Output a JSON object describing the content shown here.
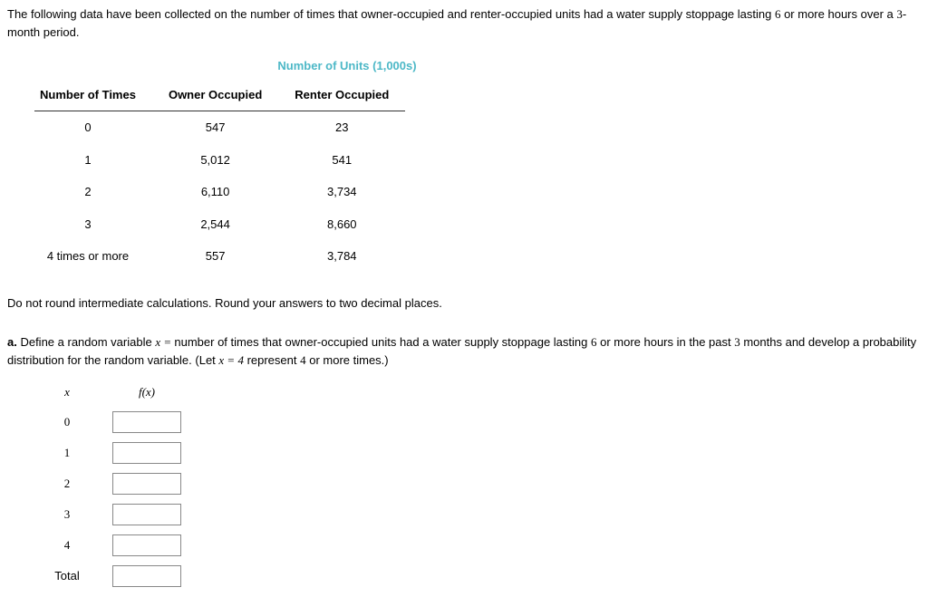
{
  "intro_part1": "The following data have been collected on the number of times that owner-occupied and renter-occupied units had a water supply stoppage lasting ",
  "intro_num1": "6",
  "intro_part2": " or more hours over a ",
  "intro_num2": "3",
  "intro_part3": "-month period.",
  "super_header": "Number of Units (1,000s)",
  "headers": {
    "col1": "Number of Times",
    "col2": "Owner Occupied",
    "col3": "Renter Occupied"
  },
  "rows": [
    {
      "times": "0",
      "owner": "547",
      "renter": "23"
    },
    {
      "times": "1",
      "owner": "5,012",
      "renter": "541"
    },
    {
      "times": "2",
      "owner": "6,110",
      "renter": "3,734"
    },
    {
      "times": "3",
      "owner": "2,544",
      "renter": "8,660"
    },
    {
      "times": "4 times or more",
      "owner": "557",
      "renter": "3,784"
    }
  ],
  "instruction": "Do not round intermediate calculations. Round your answers to two decimal places.",
  "partA": {
    "label": "a.",
    "p1": " Define a random variable ",
    "var_def": "x = ",
    "p2": "number of times that owner-occupied units had a water supply stoppage lasting ",
    "num1": "6",
    "p3": " or more hours in the past ",
    "num2": "3",
    "p4": " months and develop a probability distribution for the random variable. (Let ",
    "let": "x = 4",
    "p5": " represent ",
    "num3": "4",
    "p6": " or more times.)"
  },
  "answer_headers": {
    "x": "x",
    "fx": "f(x)"
  },
  "answer_rows": [
    {
      "x": "0"
    },
    {
      "x": "1"
    },
    {
      "x": "2"
    },
    {
      "x": "3"
    },
    {
      "x": "4"
    },
    {
      "x": "Total"
    }
  ],
  "chart_data": {
    "type": "table",
    "title": "Number of Units (1,000s)",
    "categories": [
      "0",
      "1",
      "2",
      "3",
      "4 times or more"
    ],
    "series": [
      {
        "name": "Owner Occupied",
        "values": [
          547,
          5012,
          6110,
          2544,
          557
        ]
      },
      {
        "name": "Renter Occupied",
        "values": [
          23,
          541,
          3734,
          8660,
          3784
        ]
      }
    ]
  }
}
